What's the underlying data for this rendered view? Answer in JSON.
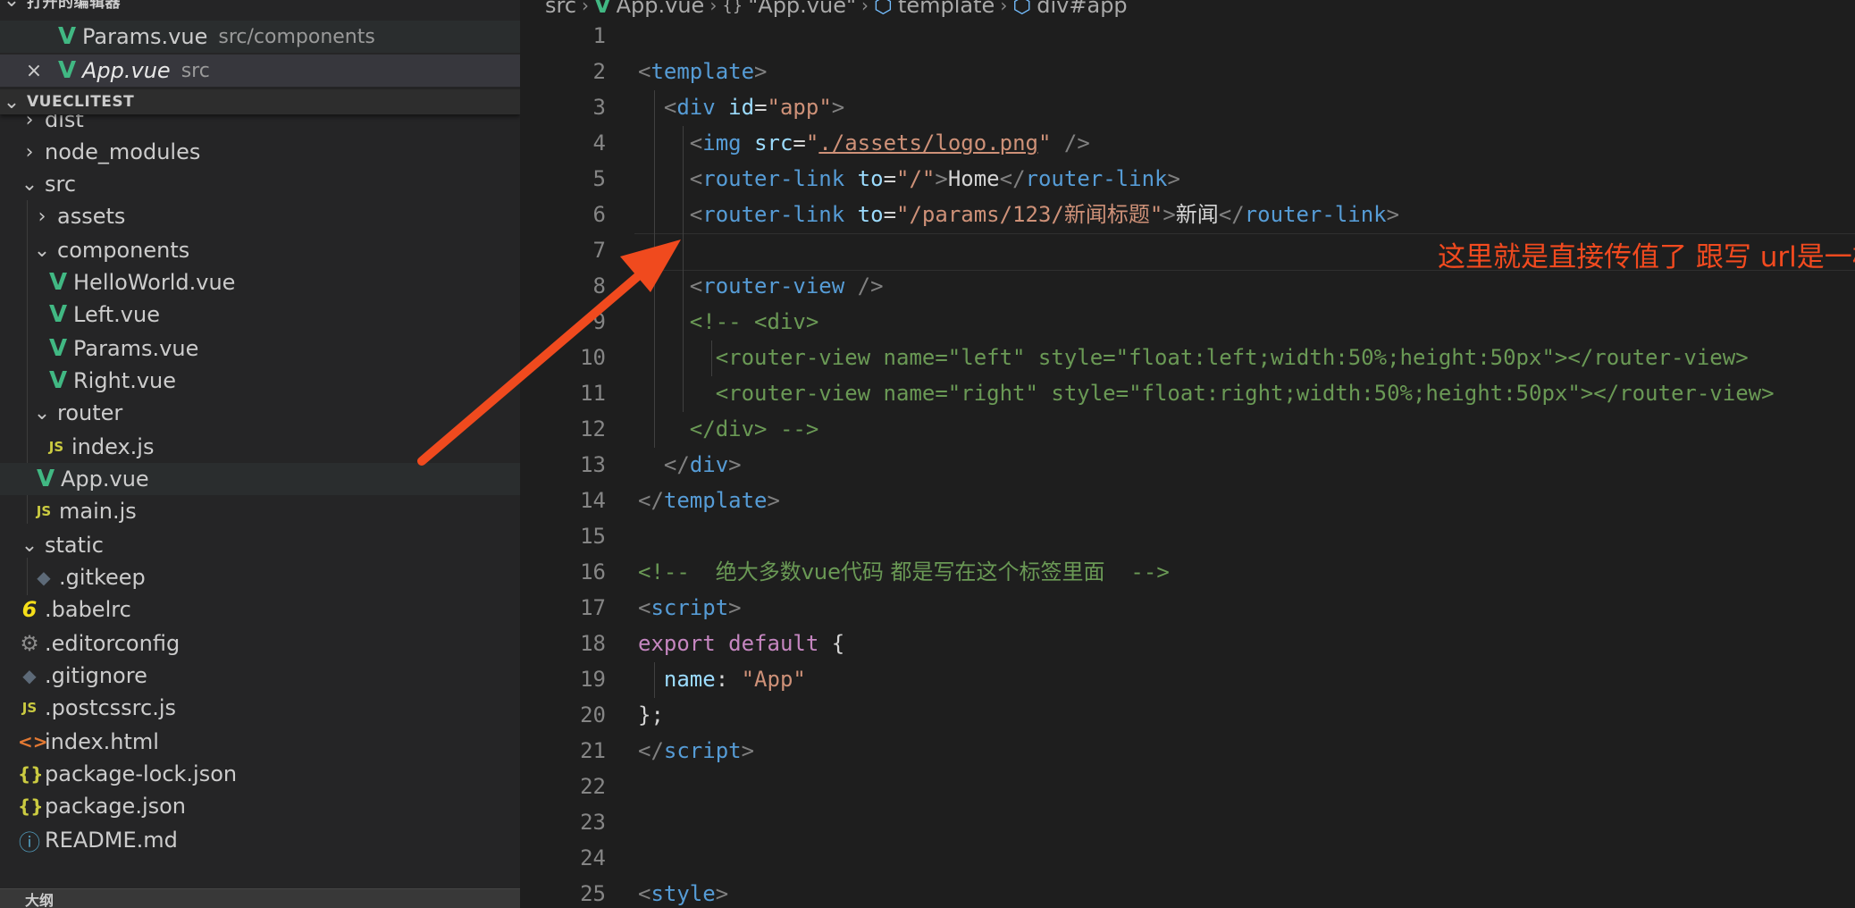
{
  "sidebar": {
    "open_editors": {
      "title": "打开的编辑器",
      "items": [
        {
          "name": "Params.vue",
          "desc": "src/components"
        },
        {
          "name": "App.vue",
          "desc": "src"
        }
      ]
    },
    "project": {
      "title": "VUECLITEST",
      "tree": [
        "dist",
        "node_modules",
        "src",
        "assets",
        "components",
        "HelloWorld.vue",
        "Left.vue",
        "Params.vue",
        "Right.vue",
        "router",
        "index.js",
        "App.vue",
        "main.js",
        "static",
        ".gitkeep",
        ".babelrc",
        ".editorconfig",
        ".gitignore",
        ".postcssrc.js",
        "index.html",
        "package-lock.json",
        "package.json",
        "README.md"
      ]
    },
    "outline_title": "大纲"
  },
  "icons": {
    "vue": "V",
    "js": "JS",
    "babel": "6",
    "gear": "⚙",
    "git": "◆",
    "html": "<>",
    "json": "{}",
    "info": "ⓘ",
    "close": "×",
    "chevron_right": "›",
    "chevron_down": "⌄"
  },
  "breadcrumb": {
    "items": [
      "src",
      "App.vue",
      "\"App.vue\"",
      "template",
      "div#app"
    ]
  },
  "editor": {
    "line_numbers": [
      "1",
      "2",
      "3",
      "4",
      "5",
      "6",
      "7",
      "8",
      "9",
      "10",
      "11",
      "12",
      "13",
      "14",
      "15",
      "16",
      "17",
      "18",
      "19",
      "20",
      "21",
      "22",
      "23",
      "24",
      "25"
    ],
    "code": {
      "l2": [
        "<",
        "template",
        ">"
      ],
      "l3": [
        "<",
        "div",
        " ",
        "id",
        "=",
        "\"app\"",
        ">"
      ],
      "l4": [
        "<",
        "img",
        " ",
        "src",
        "=",
        "\"",
        "./assets/logo.png",
        "\"",
        " />"
      ],
      "l5": [
        "<",
        "router-link",
        " ",
        "to",
        "=",
        "\"/\"",
        ">",
        "Home",
        "</",
        "router-link",
        ">"
      ],
      "l6": [
        "<",
        "router-link",
        " ",
        "to",
        "=",
        "\"/params/123/",
        "新闻标题",
        "\"",
        ">",
        "新闻",
        "</",
        "router-link",
        ">"
      ],
      "l8": [
        "<",
        "router-view",
        " />"
      ],
      "l9": "<!-- <div>",
      "l10": "<router-view name=\"left\" style=\"float:left;width:50%;height:50px\"></router-view>",
      "l11": "<router-view name=\"right\" style=\"float:right;width:50%;height:50px\"></router-view>",
      "l12": "</div> -->",
      "l13": [
        "</",
        "div",
        ">"
      ],
      "l14": [
        "</",
        "template",
        ">"
      ],
      "l16": [
        "<!--  ",
        "绝大多数vue代码 都是写在这个标签里面",
        "  -->"
      ],
      "l17": [
        "<",
        "script",
        ">"
      ],
      "l18": [
        "export",
        " ",
        "default",
        " {"
      ],
      "l19": [
        "name",
        ": ",
        "\"App\""
      ],
      "l20": "};",
      "l21": [
        "</",
        "script",
        ">"
      ],
      "l25": [
        "<",
        "style",
        ">"
      ]
    }
  },
  "annotation": {
    "text": "这里就是直接传值了 跟写 url是一样的",
    "color": "#f24a1f"
  }
}
